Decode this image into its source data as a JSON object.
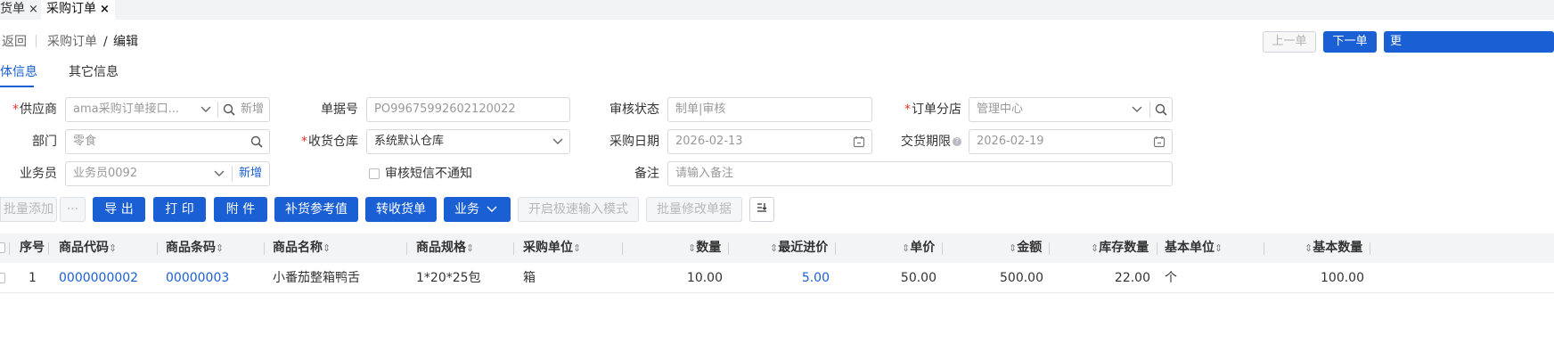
{
  "tabs": [
    {
      "label": "货单",
      "close": "×"
    },
    {
      "label": "采购订单",
      "close": "×"
    }
  ],
  "header": {
    "back": "返回",
    "crumb_parent": "采购订单",
    "crumb_sep": "/",
    "crumb_current": "编辑",
    "prev_btn": "上一单",
    "next_btn": "下一单",
    "more_btn": "更"
  },
  "subtabs": {
    "basic": "体信息",
    "other": "其它信息"
  },
  "form": {
    "supplier": {
      "label": "供应商",
      "value": "ama采购订单接口...",
      "add": "新增"
    },
    "doc_no": {
      "label": "单据号",
      "value": "PO99675992602120022"
    },
    "audit_status": {
      "label": "审核状态",
      "placeholder": "制单|审核"
    },
    "branch": {
      "label": "订单分店",
      "value": "管理中心"
    },
    "dept": {
      "label": "部门",
      "value": "零食"
    },
    "warehouse": {
      "label": "收货仓库",
      "value": "系统默认仓库"
    },
    "purchase_date": {
      "label": "采购日期",
      "value": "2026-02-13"
    },
    "delivery_date": {
      "label": "交货期限",
      "help": "?",
      "value": "2026-02-19"
    },
    "salesman": {
      "label": "业务员",
      "value": "业务员0092",
      "add": "新增"
    },
    "sms": {
      "label": "审核短信不通知"
    },
    "remark": {
      "label": "备注",
      "placeholder": "请输入备注"
    }
  },
  "toolbar": {
    "batch_add": "批量添加",
    "more": "···",
    "export": "导 出",
    "print": "打 印",
    "attach": "附 件",
    "restock": "补货参考值",
    "to_receipt": "转收货单",
    "business": "业务",
    "quick_mode": "开启极速输入模式",
    "batch_edit": "批量修改单据",
    "settings_icon": "column-settings-icon"
  },
  "table": {
    "headers": {
      "seq": "序号",
      "code": "商品代码",
      "barcode": "商品条码",
      "name": "商品名称",
      "spec": "商品规格",
      "unit": "采购单位",
      "qty": "数量",
      "recent_price": "最近进价",
      "price": "单价",
      "amount": "金额",
      "stock": "库存数量",
      "base_unit": "基本单位",
      "base_qty": "基本数量"
    },
    "sort_glyph": "⇕",
    "rows": [
      {
        "seq": "1",
        "code": "0000000002",
        "barcode": "00000003",
        "name": "小番茄整箱鸭舌",
        "spec": "1*20*25包",
        "unit": "箱",
        "qty": "10.00",
        "recent_price": "5.00",
        "price": "50.00",
        "amount": "500.00",
        "stock": "22.00",
        "base_unit": "个",
        "base_qty": "100.00"
      }
    ]
  },
  "colors": {
    "primary": "#1a5fd3",
    "required": "#e0362c"
  }
}
